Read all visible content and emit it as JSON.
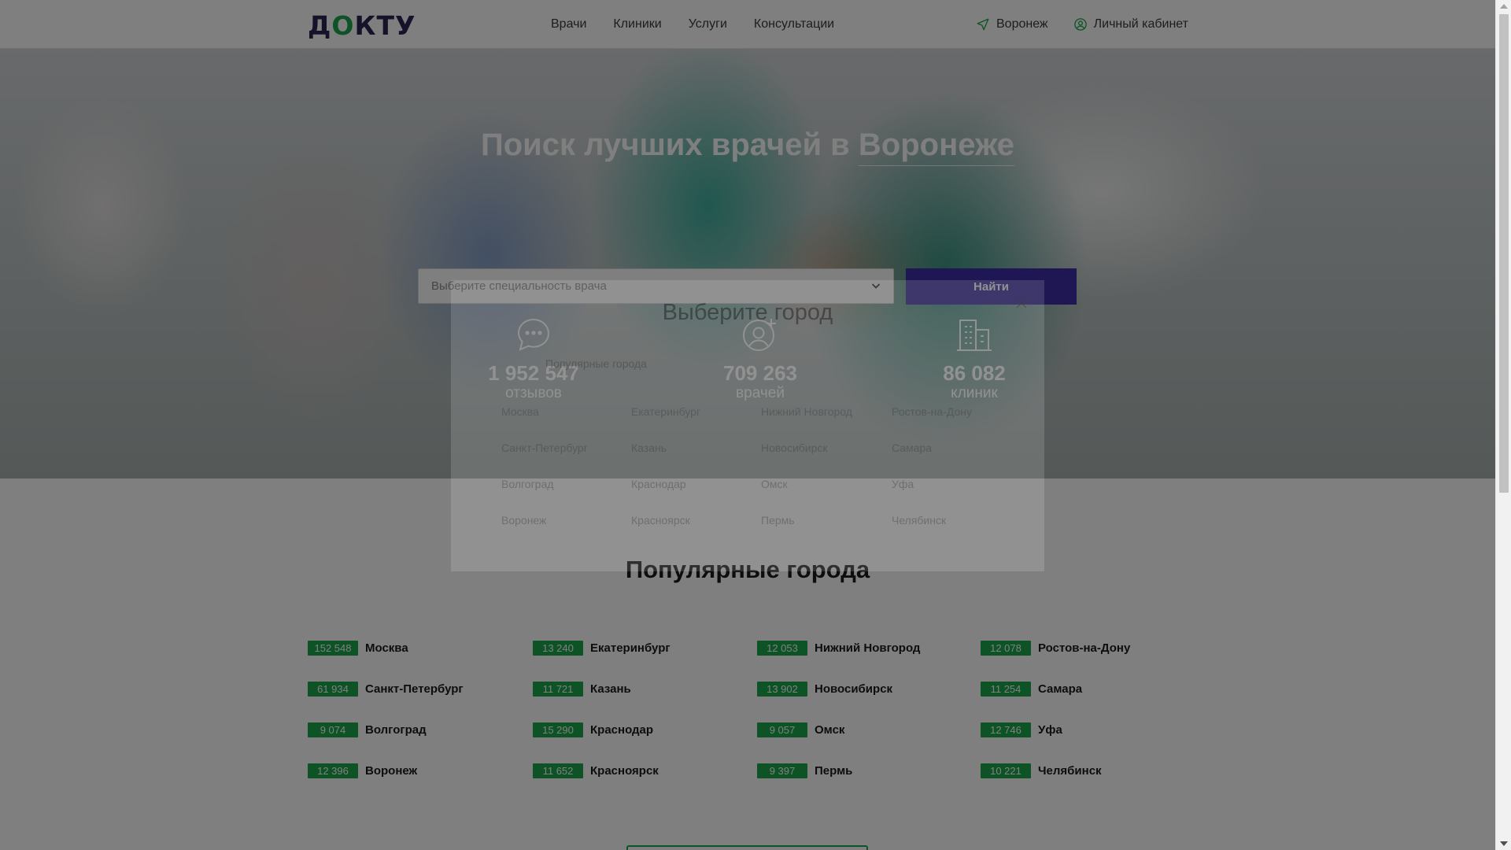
{
  "header": {
    "logo": "ДОКТУ",
    "nav": [
      "Врачи",
      "Клиники",
      "Услуги",
      "Консультации"
    ],
    "location": "Воронеж",
    "account": "Личный кабинет",
    "icons": {
      "location": "navigation-arrow-icon",
      "account": "user-circle-icon"
    }
  },
  "hero": {
    "title_prefix": "Поиск лучших врачей в",
    "title_city": "Воронеже",
    "search_placeholder": "Выберите специальность врача",
    "search_button": "Найти",
    "stats": [
      {
        "value": "1 952 547",
        "label": "отзывов",
        "icon": "chat-bubble-icon"
      },
      {
        "value": "709 263",
        "label": "врачей",
        "icon": "add-user-icon"
      },
      {
        "value": "86 082",
        "label": "клиник",
        "icon": "buildings-icon"
      }
    ]
  },
  "popular": {
    "title": "Популярные города",
    "cities": [
      {
        "count": "152 548",
        "name": "Москва"
      },
      {
        "count": "13 240",
        "name": "Екатеринбург"
      },
      {
        "count": "12 053",
        "name": "Нижний Новгород"
      },
      {
        "count": "12 078",
        "name": "Ростов-на-Дону"
      },
      {
        "count": "61 934",
        "name": "Санкт-Петербург"
      },
      {
        "count": "11 721",
        "name": "Казань"
      },
      {
        "count": "13 902",
        "name": "Новосибирск"
      },
      {
        "count": "11 254",
        "name": "Самара"
      },
      {
        "count": "9 074",
        "name": "Волгоград"
      },
      {
        "count": "15 290",
        "name": "Краснодар"
      },
      {
        "count": "9 057",
        "name": "Омск"
      },
      {
        "count": "12 746",
        "name": "Уфа"
      },
      {
        "count": "12 396",
        "name": "Воронеж"
      },
      {
        "count": "11 652",
        "name": "Красноярск"
      },
      {
        "count": "9 397",
        "name": "Пермь"
      },
      {
        "count": "10 221",
        "name": "Челябинск"
      }
    ]
  },
  "modal": {
    "title": "Выберите город",
    "subtitle": "Популярные города",
    "cities": [
      "Москва",
      "Екатеринбург",
      "Нижний Новгород",
      "Ростов-на-Дону",
      "Санкт-Петербург",
      "Казань",
      "Новосибирск",
      "Самара",
      "Волгоград",
      "Краснодар",
      "Омск",
      "Уфа",
      "Воронеж",
      "Красноярск",
      "Пермь",
      "Челябинск"
    ]
  },
  "colors": {
    "brand": "#3c2fa6",
    "accent": "#1aa64c",
    "logo_dark": "#2a2554"
  }
}
